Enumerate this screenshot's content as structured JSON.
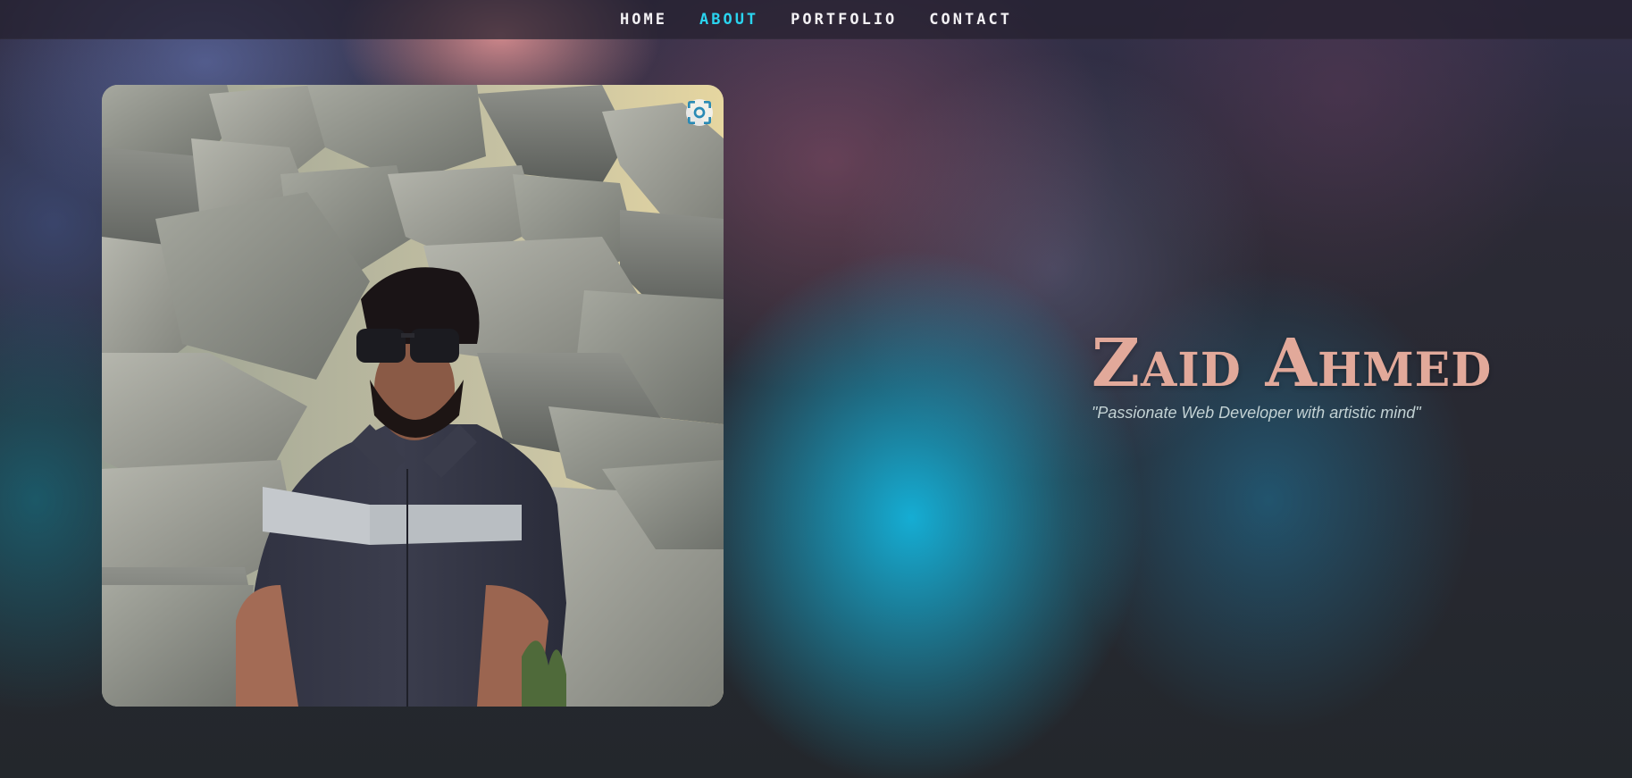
{
  "nav": {
    "items": [
      {
        "label": "HOME"
      },
      {
        "label": "ABOUT"
      },
      {
        "label": "PORTFOLIO"
      },
      {
        "label": "CONTACT"
      }
    ],
    "active_index": 1,
    "accent_color": "#2ad4ef"
  },
  "photo": {
    "subject": "man-in-sunglasses-sitting-by-rocks",
    "overlay_icon": "lens-scan-icon"
  },
  "hero": {
    "name": "Zaid Ahmed",
    "tagline": "\"Passionate Web Developer with artistic mind\"",
    "name_color": "#e2a99a",
    "tagline_color": "#c3d2d4"
  }
}
